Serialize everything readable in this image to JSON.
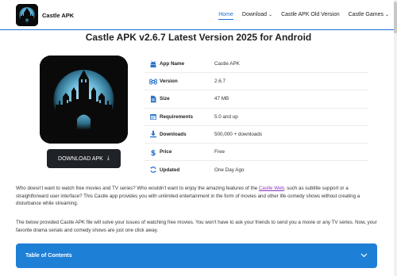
{
  "header": {
    "logo_text": "Castle APK",
    "nav": [
      {
        "label": "Home",
        "dropdown": false,
        "active": true
      },
      {
        "label": "Download",
        "dropdown": true,
        "active": false
      },
      {
        "label": "Castle APK Old Version",
        "dropdown": false,
        "active": false
      },
      {
        "label": "Castle Games",
        "dropdown": true,
        "active": false
      }
    ]
  },
  "title": "Castle APK v2.6.7 Latest Version 2025 for Android",
  "download_button": {
    "label": "DOWNLOAD APK"
  },
  "info": [
    {
      "icon": "android-icon",
      "label": "App Name",
      "value": "Castle APK"
    },
    {
      "icon": "command-icon",
      "label": "Version",
      "value": "2.6.7"
    },
    {
      "icon": "file-icon",
      "label": "Size",
      "value": "47 MB"
    },
    {
      "icon": "calendar-icon",
      "label": "Requirements",
      "value": "5.0 and up"
    },
    {
      "icon": "download-icon",
      "label": "Downloads",
      "value": "500,000 + downloads"
    },
    {
      "icon": "dollar-icon",
      "label": "Price",
      "value": "Free"
    },
    {
      "icon": "refresh-icon",
      "label": "Updated",
      "value": "One Day Ago"
    }
  ],
  "paragraph1": {
    "before": "Who doesn't want to watch free movies and TV series? Who wouldn't want to enjoy the amazing features of the ",
    "link": "Castle Web",
    "after": ", such as subtitle support or a straightforward user interface? This Castle app provides you with unlimited entertainment in the form of movies and other life comedy shows without creating a disturbance while streaming."
  },
  "paragraph2": "The below provided Castle APK file will solve your issues of watching free movies. You won't have to ask your friends to send you a movie or any TV series. Now, your favorite drama serials and comedy shows are just one click away.",
  "toc": {
    "label": "Table of Contents"
  },
  "colors": {
    "accent": "#1f6fd1",
    "toc_bg": "#1e7fd6",
    "button_bg": "#1f2227",
    "icon_blue": "#2a73c9"
  }
}
